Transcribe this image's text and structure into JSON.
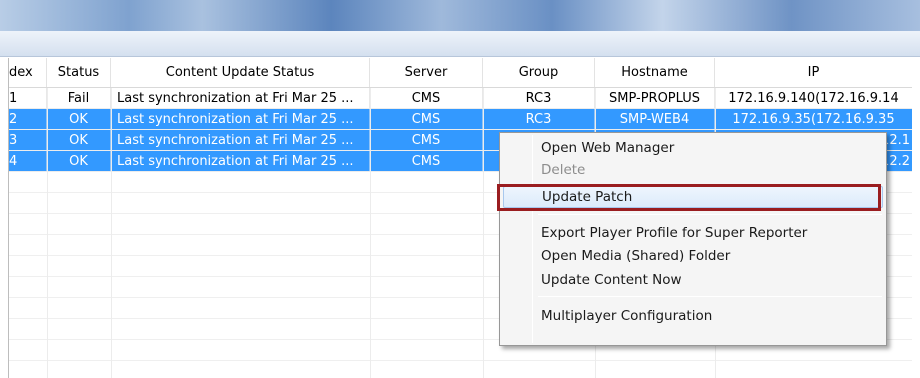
{
  "table": {
    "columns": {
      "index": "dex",
      "status": "Status",
      "content": "Content Update Status",
      "server": "Server",
      "group": "Group",
      "hostname": "Hostname",
      "ip": "IP"
    },
    "rows": [
      {
        "index": "1",
        "status": "Fail",
        "content": "Last synchronization at Fri Mar 25 ...",
        "server": "CMS",
        "group": "RC3",
        "hostname": "SMP-PROPLUS",
        "ip": "172.16.9.140(172.16.9.14",
        "selected": false
      },
      {
        "index": "2",
        "status": "OK",
        "content": "Last synchronization at Fri Mar 25 ...",
        "server": "CMS",
        "group": "RC3",
        "hostname": "SMP-WEB4",
        "ip": "172.16.9.35(172.16.9.35",
        "selected": true
      },
      {
        "index": "3",
        "status": "OK",
        "content": "Last synchronization at Fri Mar 25 ...",
        "server": "CMS",
        "group": "",
        "hostname": "",
        "ip": "12.1",
        "selected": true
      },
      {
        "index": "4",
        "status": "OK",
        "content": "Last synchronization at Fri Mar 25 ...",
        "server": "CMS",
        "group": "",
        "hostname": "",
        "ip": "12.2",
        "selected": true
      }
    ]
  },
  "context_menu": {
    "items": [
      {
        "label": "Open Web Manager",
        "enabled": true
      },
      {
        "label": "Delete",
        "enabled": false
      },
      {
        "label": "Update Patch",
        "enabled": true,
        "highlighted": true
      },
      {
        "label": "Export Player Profile for Super Reporter",
        "enabled": true
      },
      {
        "label": "Open Media (Shared) Folder",
        "enabled": true
      },
      {
        "label": "Update Content Now",
        "enabled": true
      },
      {
        "label": "Multiplayer Configuration",
        "enabled": true
      }
    ]
  },
  "colors": {
    "selection": "#3399ff",
    "highlight_box": "#9a1d20"
  }
}
